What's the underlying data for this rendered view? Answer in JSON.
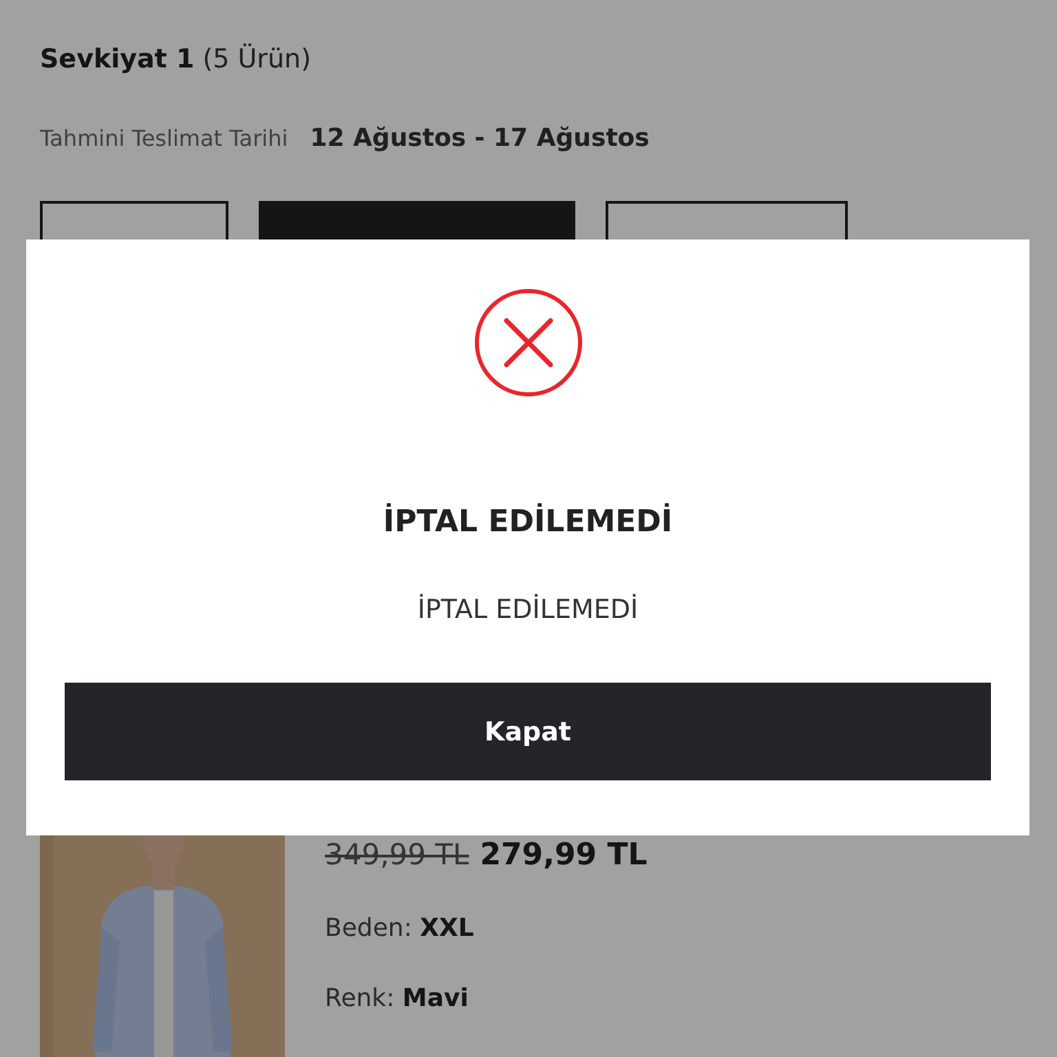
{
  "shipment": {
    "title": "Sevkiyat 1",
    "count": "(5 Ürün)",
    "delivery_label": "Tahmini Teslimat Tarihi",
    "delivery_dates": "12 Ağustos - 17 Ağustos"
  },
  "action_buttons": [
    {
      "kind": "outline"
    },
    {
      "kind": "filled"
    },
    {
      "kind": "outline"
    }
  ],
  "product": {
    "old_price": "349,99 TL",
    "price": "279,99 TL",
    "size_label": "Beden:",
    "size": "XXL",
    "color_label": "Renk:",
    "color_name": "Mavi"
  },
  "dialog": {
    "title": "İPTAL EDİLEMEDİ",
    "message": "İPTAL EDİLEMEDİ",
    "button": "Kapat"
  }
}
